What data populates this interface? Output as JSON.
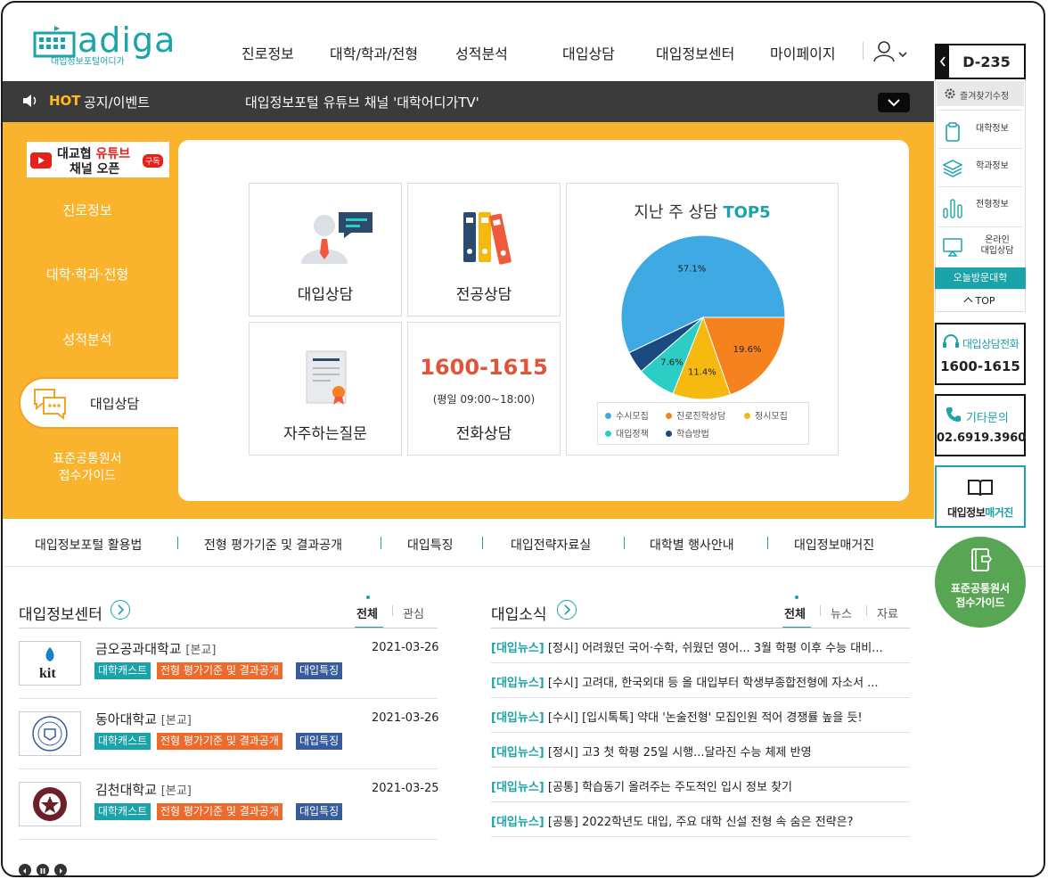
{
  "header": {
    "logo": "adiga",
    "logo_sub": "대입정보포털어디가",
    "nav": [
      "진로정보",
      "대학/학과/전형",
      "성적분석",
      "대입상담",
      "대입정보센터",
      "마이페이지"
    ]
  },
  "hot": {
    "label": "HOT",
    "label2": "공지/이벤트",
    "text": "대입정보포털 유튜브 채널 '대학어디가TV'"
  },
  "banner": {
    "line1": "대교협",
    "line1b": "유튜브",
    "line2": "채널 오픈",
    "sub": "구독"
  },
  "side_menu": [
    "진로정보",
    "대학·학과·전형",
    "성적분석",
    "대입상담",
    "표준공통원서",
    "접수가이드"
  ],
  "cards": {
    "consult": "대입상담",
    "major": "전공상담",
    "faq": "자주하는질문",
    "phone_number": "1600-1615",
    "phone_hours": "(평일 09:00~18:00)",
    "phone_label": "전화상담"
  },
  "pie_title": "지난 주 상담",
  "pie_title_accent": "TOP5",
  "chart_data": {
    "type": "pie",
    "title": "지난 주 상담 TOP5",
    "labels": [
      "수시모집",
      "진로진학상담",
      "정시모집",
      "대입정책",
      "학습방법"
    ],
    "values": [
      57.1,
      19.6,
      11.4,
      7.6,
      4.3
    ],
    "value_labels": [
      "57.1%",
      "19.6%",
      "11.4%",
      "7.6%",
      ""
    ],
    "colors": [
      "#3ea9e2",
      "#f5821f",
      "#f6b90f",
      "#2ccdc4",
      "#1a4a80"
    ],
    "legend": "bottom"
  },
  "subnav": [
    "대입정보포털 활용법",
    "전형 평가기준 및 결과공개",
    "대입특징",
    "대입전략자료실",
    "대학별 행사안내",
    "대입정보매거진"
  ],
  "center": {
    "title": "대입정보센터",
    "tabs": [
      "전체",
      "관심"
    ],
    "rows": [
      {
        "name": "금오공과대학교",
        "campus": "[본교]",
        "date": "2021-03-26",
        "logo": "kit"
      },
      {
        "name": "동아대학교",
        "campus": "[본교]",
        "date": "2021-03-26",
        "logo": ""
      },
      {
        "name": "김천대학교",
        "campus": "[본교]",
        "date": "2021-03-25",
        "logo": ""
      }
    ],
    "badges": [
      "대학캐스트",
      "전형 평가기준 및 결과공개",
      "대입특징"
    ]
  },
  "news": {
    "title": "대입소식",
    "tabs": [
      "전체",
      "뉴스",
      "자료"
    ],
    "tag": "[대입뉴스]",
    "items": [
      "[정시] 어려웠던 국어·수학, 쉬웠던 영어... 3월 학평 이후 수능 대비...",
      "[수시] 고려대, 한국외대 등 올 대입부터 학생부종합전형에 자소서 ...",
      "[수시] [입시톡톡] 약대 '논술전형' 모집인원 적어 경쟁률 높을 듯!",
      "[정시] 고3 첫 학평 25일 시행...달라진 수능 체제 반영",
      "[공통] 학습동기 올려주는 주도적인 입시 정보 찾기",
      "[공통] 2022학년도 대입, 주요 대학 신설 전형 속 숨은 전략은?"
    ]
  },
  "right": {
    "dday": "D-235",
    "fav_edit": "즐겨찾기수정",
    "items": [
      "대학정보",
      "학과정보",
      "전형정보",
      "온라인",
      "대입상담"
    ],
    "today": "오늘방문대학",
    "top": "TOP",
    "call_label": "대입상담전화",
    "call_number": "1600-1615",
    "etc_label": "기타문의",
    "etc_number": "02.6919.3960",
    "mag_label": "대입정보",
    "mag_accent": "매거진",
    "guide1": "표준공통원서",
    "guide2": "접수가이드"
  }
}
